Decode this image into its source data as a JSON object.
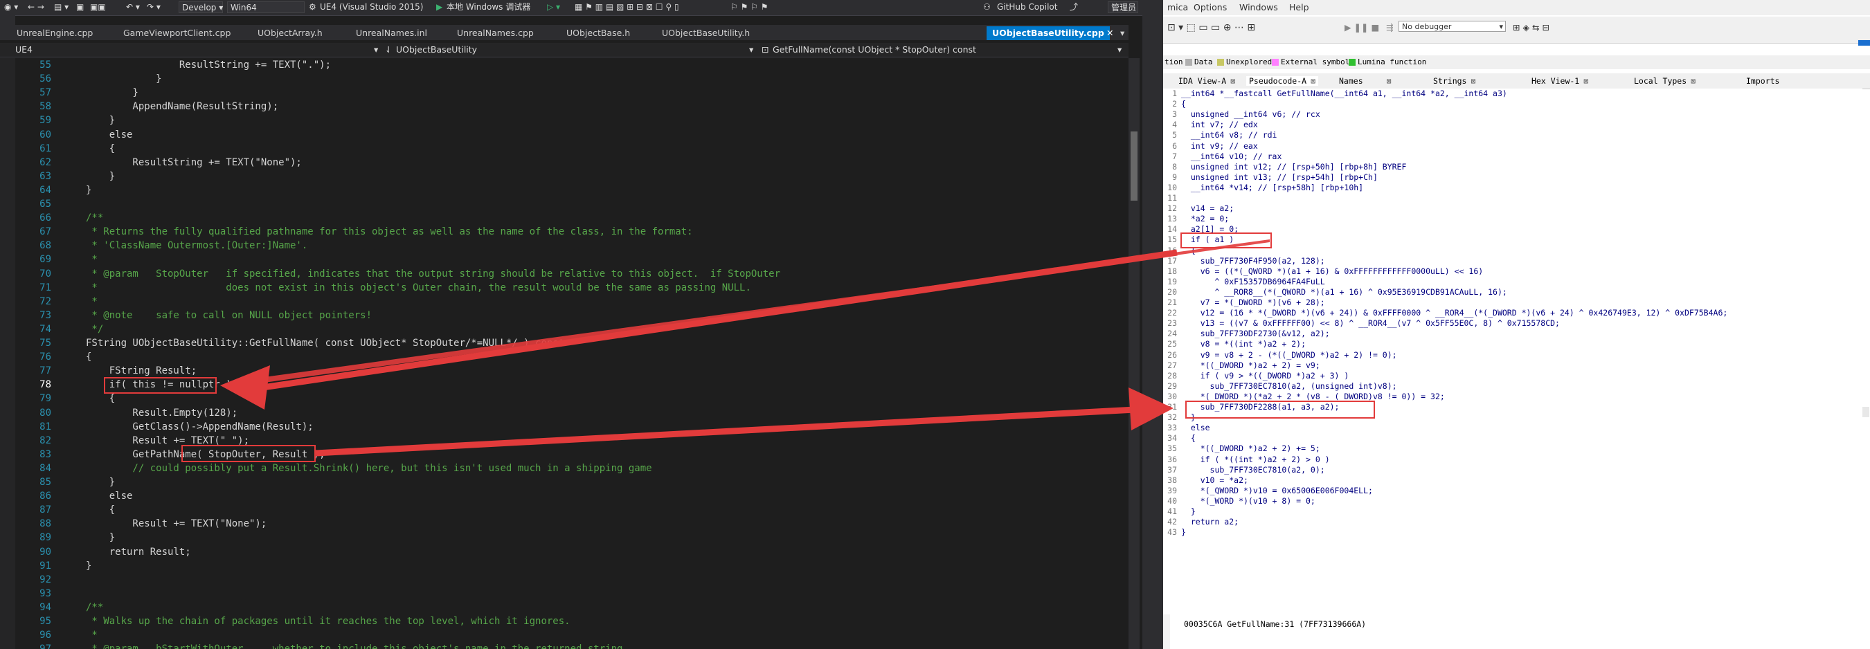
{
  "vs": {
    "toolbar": {
      "config": "Develop",
      "platform": "Win64",
      "project": "UE4 (Visual Studio 2015)",
      "debugger": "本地 Windows 调试器",
      "copilot": "GitHub Copilot",
      "admin": "管理员"
    },
    "tabs": [
      {
        "label": "UnrealEngine.cpp"
      },
      {
        "label": "GameViewportClient.cpp"
      },
      {
        "label": "UObjectArray.h"
      },
      {
        "label": "UnrealNames.inl"
      },
      {
        "label": "UnrealNames.cpp"
      },
      {
        "label": "UObjectBase.h"
      },
      {
        "label": "UObjectBaseUtility.h"
      },
      {
        "label": "UObjectBaseUtility.cpp"
      }
    ],
    "nav": {
      "project": "UE4",
      "scope": "UObjectBaseUtility",
      "member": "GetFullName(const UObject * StopOuter) const"
    },
    "code": [
      {
        "n": "55",
        "text": "                ResultString += TEXT(\".\");"
      },
      {
        "n": "56",
        "text": "            }"
      },
      {
        "n": "57",
        "text": "        }"
      },
      {
        "n": "58",
        "text": "        AppendName(ResultString);"
      },
      {
        "n": "59",
        "text": "    }"
      },
      {
        "n": "60",
        "text": "    else"
      },
      {
        "n": "61",
        "text": "    {"
      },
      {
        "n": "62",
        "text": "        ResultString += TEXT(\"None\");"
      },
      {
        "n": "63",
        "text": "    }"
      },
      {
        "n": "64",
        "text": "}"
      },
      {
        "n": "65",
        "text": ""
      },
      {
        "n": "66",
        "text": "/**"
      },
      {
        "n": "67",
        "text": " * Returns the fully qualified pathname for this object as well as the name of the class, in the format:"
      },
      {
        "n": "68",
        "text": " * 'ClassName Outermost.[Outer:]Name'."
      },
      {
        "n": "69",
        "text": " *"
      },
      {
        "n": "70",
        "text": " * @param   StopOuter   if specified, indicates that the output string should be relative to this object.  if StopOuter"
      },
      {
        "n": "71",
        "text": " *                      does not exist in this object's Outer chain, the result would be the same as passing NULL."
      },
      {
        "n": "72",
        "text": " *"
      },
      {
        "n": "73",
        "text": " * @note    safe to call on NULL object pointers!"
      },
      {
        "n": "74",
        "text": " */"
      },
      {
        "n": "75",
        "text": "FString UObjectBaseUtility::GetFullName( const UObject* StopOuter/*=NULL*/ ) const"
      },
      {
        "n": "76",
        "text": "{"
      },
      {
        "n": "77",
        "text": "    FString Result;"
      },
      {
        "n": "78",
        "text": "    if( this != nullptr )"
      },
      {
        "n": "79",
        "text": "    {"
      },
      {
        "n": "80",
        "text": "        Result.Empty(128);"
      },
      {
        "n": "81",
        "text": "        GetClass()->AppendName(Result);"
      },
      {
        "n": "82",
        "text": "        Result += TEXT(\" \");"
      },
      {
        "n": "83",
        "text": "        GetPathName( StopOuter, Result );"
      },
      {
        "n": "84",
        "text": "        // could possibly put a Result.Shrink() here, but this isn't used much in a shipping game"
      },
      {
        "n": "85",
        "text": "    }"
      },
      {
        "n": "86",
        "text": "    else"
      },
      {
        "n": "87",
        "text": "    {"
      },
      {
        "n": "88",
        "text": "        Result += TEXT(\"None\");"
      },
      {
        "n": "89",
        "text": "    }"
      },
      {
        "n": "90",
        "text": "    return Result;"
      },
      {
        "n": "91",
        "text": "}"
      },
      {
        "n": "92",
        "text": ""
      },
      {
        "n": "93",
        "text": ""
      },
      {
        "n": "94",
        "text": "/**"
      },
      {
        "n": "95",
        "text": " * Walks up the chain of packages until it reaches the top level, which it ignores."
      },
      {
        "n": "96",
        "text": " *"
      },
      {
        "n": "97",
        "text": " * @param   bStartWithOuter     whether to include this object's name in the returned string"
      }
    ]
  },
  "ida": {
    "menu": [
      "mica",
      "Options",
      "Windows",
      "Help"
    ],
    "debugger_select": "No debugger",
    "legend": [
      {
        "label": "tion",
        "color": "#f0f0f0"
      },
      {
        "label": "Data",
        "color": "#b0b0b0"
      },
      {
        "label": "Unexplored",
        "color": "#c8c864"
      },
      {
        "label": "External symbol",
        "color": "#ff80ff"
      },
      {
        "label": "Lumina function",
        "color": "#30c030"
      }
    ],
    "tabs": [
      {
        "label": "IDA View-A"
      },
      {
        "label": "Pseudocode-A"
      },
      {
        "label": "Names"
      },
      {
        "label": "Strings"
      },
      {
        "label": "Hex View-1"
      },
      {
        "label": "Local Types"
      },
      {
        "label": "Imports"
      }
    ],
    "code": [
      {
        "n": "1",
        "text": "__int64 *__fastcall GetFullName(__int64 a1, __int64 *a2, __int64 a3)"
      },
      {
        "n": "2",
        "text": "{"
      },
      {
        "n": "3",
        "text": "  unsigned __int64 v6; // rcx"
      },
      {
        "n": "4",
        "text": "  int v7; // edx"
      },
      {
        "n": "5",
        "text": "  __int64 v8; // rdi"
      },
      {
        "n": "6",
        "text": "  int v9; // eax"
      },
      {
        "n": "7",
        "text": "  __int64 v10; // rax"
      },
      {
        "n": "8",
        "text": "  unsigned int v12; // [rsp+50h] [rbp+8h] BYREF"
      },
      {
        "n": "9",
        "text": "  unsigned int v13; // [rsp+54h] [rbp+Ch]"
      },
      {
        "n": "10",
        "text": "  __int64 *v14; // [rsp+58h] [rbp+10h]"
      },
      {
        "n": "11",
        "text": ""
      },
      {
        "n": "12",
        "text": "  v14 = a2;"
      },
      {
        "n": "13",
        "text": "  *a2 = 0;"
      },
      {
        "n": "14",
        "text": "  a2[1] = 0;"
      },
      {
        "n": "15",
        "text": "  if ( a1 )"
      },
      {
        "n": "16",
        "text": "  {"
      },
      {
        "n": "17",
        "text": "    sub_7FF730F4F950(a2, 128);"
      },
      {
        "n": "18",
        "text": "    v6 = ((*(_QWORD *)(a1 + 16) & 0xFFFFFFFFFFFF0000uLL) << 16)"
      },
      {
        "n": "19",
        "text": "       ^ 0xF15357DB6964FA4FuLL"
      },
      {
        "n": "20",
        "text": "       ^ __ROR8__(*(_QWORD *)(a1 + 16) ^ 0x95E36919CDB91ACAuLL, 16);"
      },
      {
        "n": "21",
        "text": "    v7 = *(_DWORD *)(v6 + 28);"
      },
      {
        "n": "22",
        "text": "    v12 = (16 * *(_DWORD *)(v6 + 24)) & 0xFFFF0000 ^ __ROR4__(*(_DWORD *)(v6 + 24) ^ 0x426749E3, 12) ^ 0xDF75B4A6;"
      },
      {
        "n": "23",
        "text": "    v13 = ((v7 & 0xFFFFFF00) << 8) ^ __ROR4__(v7 ^ 0x5FF55E0C, 8) ^ 0x715578CD;"
      },
      {
        "n": "24",
        "text": "    sub_7FF730DF2730(&v12, a2);"
      },
      {
        "n": "25",
        "text": "    v8 = *((int *)a2 + 2);"
      },
      {
        "n": "26",
        "text": "    v9 = v8 + 2 - (*((_DWORD *)a2 + 2) != 0);"
      },
      {
        "n": "27",
        "text": "    *((_DWORD *)a2 + 2) = v9;"
      },
      {
        "n": "28",
        "text": "    if ( v9 > *((_DWORD *)a2 + 3) )"
      },
      {
        "n": "29",
        "text": "      sub_7FF730EC7810(a2, (unsigned int)v8);"
      },
      {
        "n": "30",
        "text": "    *(_DWORD *)(*a2 + 2 * (v8 - (_DWORD)v8 != 0)) = 32;"
      },
      {
        "n": "31",
        "text": "    sub_7FF730DF2288(a1, a3, a2);"
      },
      {
        "n": "32",
        "text": "  }"
      },
      {
        "n": "33",
        "text": "  else"
      },
      {
        "n": "34",
        "text": "  {"
      },
      {
        "n": "35",
        "text": "    *((_DWORD *)a2 + 2) += 5;"
      },
      {
        "n": "36",
        "text": "    if ( *((int *)a2 + 2) > 0 )"
      },
      {
        "n": "37",
        "text": "      sub_7FF730EC7810(a2, 0);"
      },
      {
        "n": "38",
        "text": "    v10 = *a2;"
      },
      {
        "n": "39",
        "text": "    *(_QWORD *)v10 = 0x65006E006F004ELL;"
      },
      {
        "n": "40",
        "text": "    *(_WORD *)(v10 + 8) = 0;"
      },
      {
        "n": "41",
        "text": "  }"
      },
      {
        "n": "42",
        "text": "  return a2;"
      },
      {
        "n": "43",
        "text": "}"
      }
    ],
    "status": "00035C6A GetFullName:31 (7FF73139666A)"
  },
  "colors": {
    "vs_accent": "#007acc",
    "annotation_red": "#e23b3b",
    "vs_bg": "#1e1e1e",
    "ida_bg": "#ffffff"
  }
}
